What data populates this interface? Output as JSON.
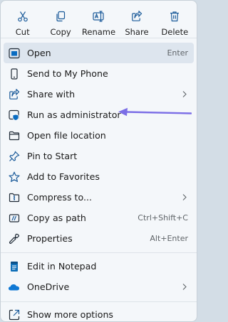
{
  "toolbar": {
    "items": [
      {
        "label": "Cut",
        "icon": "scissors-icon"
      },
      {
        "label": "Copy",
        "icon": "copy-icon"
      },
      {
        "label": "Rename",
        "icon": "rename-icon"
      },
      {
        "label": "Share",
        "icon": "share-icon"
      },
      {
        "label": "Delete",
        "icon": "trash-icon"
      }
    ]
  },
  "menu": {
    "open": {
      "label": "Open",
      "shortcut": "Enter"
    },
    "send_to_phone": {
      "label": "Send to My Phone"
    },
    "share_with": {
      "label": "Share with"
    },
    "run_as_admin": {
      "label": "Run as administrator"
    },
    "open_file_location": {
      "label": "Open file location"
    },
    "pin_to_start": {
      "label": "Pin to Start"
    },
    "add_to_favorites": {
      "label": "Add to Favorites"
    },
    "compress_to": {
      "label": "Compress to..."
    },
    "copy_as_path": {
      "label": "Copy as path",
      "shortcut": "Ctrl+Shift+C"
    },
    "properties": {
      "label": "Properties",
      "shortcut": "Alt+Enter"
    },
    "edit_in_notepad": {
      "label": "Edit in Notepad"
    },
    "onedrive": {
      "label": "OneDrive"
    },
    "show_more_options": {
      "label": "Show more options"
    }
  },
  "colors": {
    "accent": "#0a6cc1",
    "annotation_arrow": "#7b6ee6",
    "menu_bg": "#f4f7fa",
    "selected_bg": "#dde5ee"
  }
}
